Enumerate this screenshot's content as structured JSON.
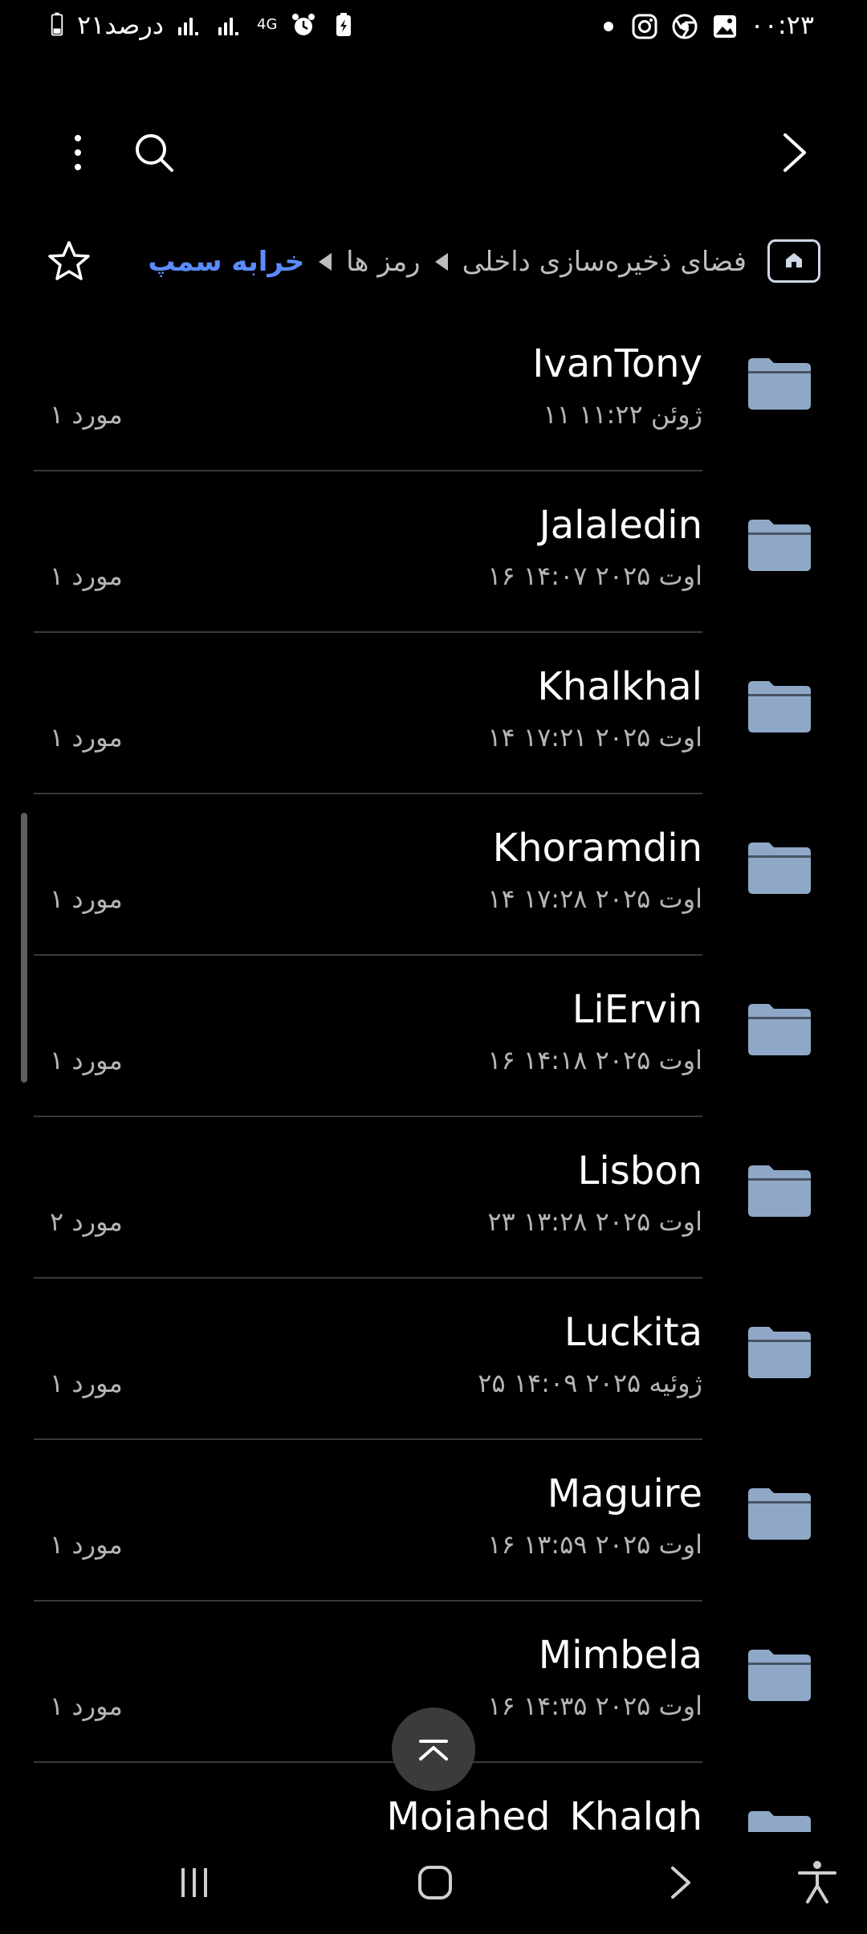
{
  "status_bar": {
    "time": "۰۰:۲۳",
    "battery_text": "۲۱درصد",
    "network": "4G"
  },
  "breadcrumb": {
    "items": [
      "فضای ذخیره‌سازی داخلی",
      "رمز ها",
      "خرابه سمپ"
    ]
  },
  "folders": [
    {
      "name": "IvanTony",
      "date": "۱۱ ژوئن ۱۱:۲۲",
      "count": "۱ مورد"
    },
    {
      "name": "Jalaledin",
      "date": "۱۶ اوت ۲۰۲۵ ۱۴:۰۷",
      "count": "۱ مورد"
    },
    {
      "name": "Khalkhal",
      "date": "۱۴ اوت ۲۰۲۵ ۱۷:۲۱",
      "count": "۱ مورد"
    },
    {
      "name": "Khoramdin",
      "date": "۱۴ اوت ۲۰۲۵ ۱۷:۲۸",
      "count": "۱ مورد"
    },
    {
      "name": "LiErvin",
      "date": "۱۶ اوت ۲۰۲۵ ۱۴:۱۸",
      "count": "۱ مورد"
    },
    {
      "name": "Lisbon",
      "date": "۲۳ اوت ۲۰۲۵ ۱۳:۲۸",
      "count": "۲ مورد"
    },
    {
      "name": "Luckita",
      "date": "۲۵ ژوئیه ۲۰۲۵ ۱۴:۰۹",
      "count": "۱ مورد"
    },
    {
      "name": "Maguire",
      "date": "۱۶ اوت ۲۰۲۵ ۱۳:۵۹",
      "count": "۱ مورد"
    },
    {
      "name": "Mimbela",
      "date": "۱۶ اوت ۲۰۲۵ ۱۴:۳۵",
      "count": "۱ مورد"
    },
    {
      "name": "Mojahed_Khalgh",
      "date": "",
      "count": ""
    }
  ],
  "colors": {
    "background": "#000000",
    "accent": "#5b8cff",
    "folder": "#8fa8c8",
    "secondary_text": "#b5b5b5"
  }
}
